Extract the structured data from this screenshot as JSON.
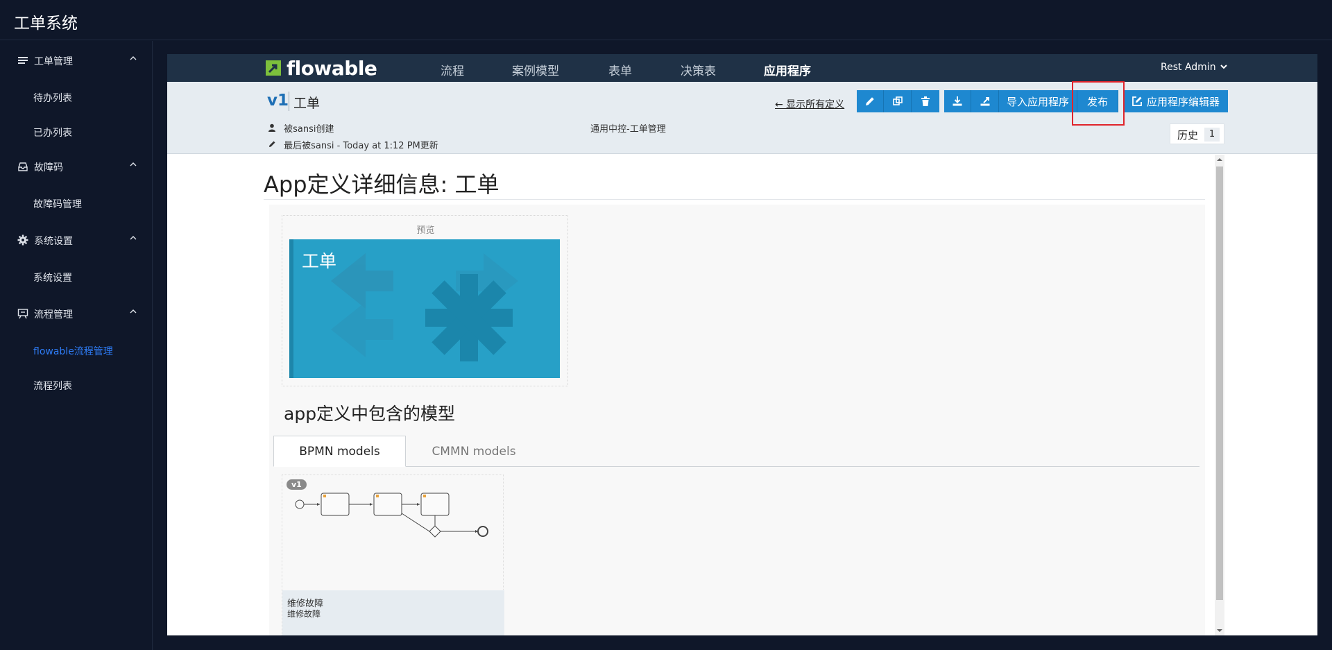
{
  "app": {
    "title": "工单系统"
  },
  "sidebar": {
    "groups": [
      {
        "label": "工单管理",
        "icon": "list-icon",
        "items": [
          "待办列表",
          "已办列表"
        ]
      },
      {
        "label": "故障码",
        "icon": "inbox-icon",
        "items": [
          "故障码管理"
        ]
      },
      {
        "label": "系统设置",
        "icon": "gear-icon",
        "items": [
          "系统设置"
        ]
      },
      {
        "label": "流程管理",
        "icon": "board-icon",
        "items": [
          "flowable流程管理",
          "流程列表"
        ]
      }
    ],
    "active_item": "flowable流程管理"
  },
  "flowable": {
    "logo_text": "flowable",
    "nav": [
      "流程",
      "案例模型",
      "表单",
      "决策表",
      "应用程序"
    ],
    "active_nav": "应用程序",
    "user": "Rest Admin"
  },
  "app_def": {
    "version": "v1",
    "name": "工单",
    "created_by": "被sansi创建",
    "updated": "最后被sansi - Today at 1:12 PM更新",
    "description": "通用中控-工单管理",
    "show_all": "← 显示所有定义",
    "buttons": {
      "edit_icon": "pencil-icon",
      "copy_icon": "copy-icon",
      "delete_icon": "trash-icon",
      "download_icon": "download-icon",
      "export_icon": "export-icon",
      "import": "导入应用程序",
      "publish": "发布",
      "editor": "应用程序编辑器"
    },
    "history_label": "历史",
    "history_count": "1"
  },
  "details": {
    "heading": "App定义详细信息: 工单",
    "preview_label": "预览",
    "tile_title": "工单",
    "models_heading": "app定义中包含的模型",
    "tabs": [
      "BPMN models",
      "CMMN models"
    ],
    "active_tab": "BPMN models",
    "models": [
      {
        "version": "v1",
        "name": "维修故障",
        "description": "维修故障"
      }
    ]
  },
  "colors": {
    "accent": "#1e88d0",
    "tile": "#27a0c7",
    "header": "#1f3146",
    "sidebar": "#0f1729",
    "active_link": "#2e7cf6",
    "highlight": "#e0242b"
  }
}
